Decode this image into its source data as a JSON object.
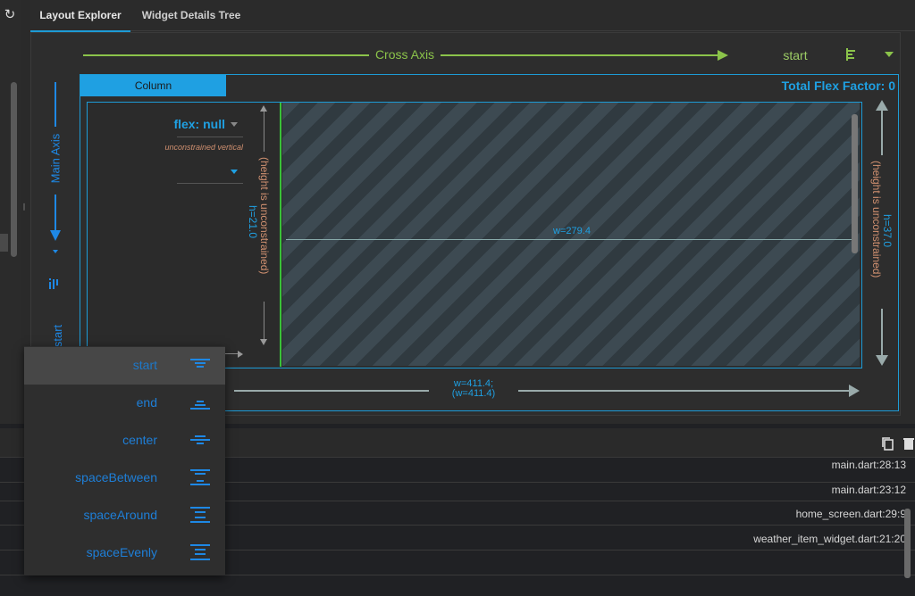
{
  "tabs": [
    {
      "label": "Layout Explorer",
      "active": true
    },
    {
      "label": "Widget Details Tree",
      "active": false
    }
  ],
  "cross_axis": {
    "label": "Cross Axis",
    "value": "start",
    "color": "#8bc34a"
  },
  "main_axis": {
    "label": "Main Axis",
    "value": "start",
    "color": "#1e88e5"
  },
  "column": {
    "label": "Column",
    "total_flex_factor": "Total Flex Factor: 0",
    "width_label_1": "w=411.4;",
    "width_label_2": "(w=411.4)",
    "height_constraint": "(height is unconstrained)",
    "height_value": "h=37.0"
  },
  "child": {
    "flex": "flex: null",
    "constraint": "unconstrained vertical",
    "height_constraint": "(height is unconstrained)",
    "height_value": "h=21.0",
    "free_width": "w=279.4"
  },
  "dropdown": {
    "options": [
      {
        "label": "start",
        "selected": true
      },
      {
        "label": "end",
        "selected": false
      },
      {
        "label": "center",
        "selected": false
      },
      {
        "label": "spaceBetween",
        "selected": false
      },
      {
        "label": "spaceAround",
        "selected": false
      },
      {
        "label": "spaceEvenly",
        "selected": false
      }
    ]
  },
  "console": {
    "rows": [
      "main.dart:28:13",
      "main.dart:23:12",
      "home_screen.dart:29:9",
      "weather_item_widget.dart:21:20"
    ]
  },
  "colors": {
    "accent": "#1fa0e2",
    "cross_axis": "#8bc34a",
    "main_axis": "#1e88e5",
    "child_border": "#39c139",
    "constraint_text": "#d09070"
  }
}
